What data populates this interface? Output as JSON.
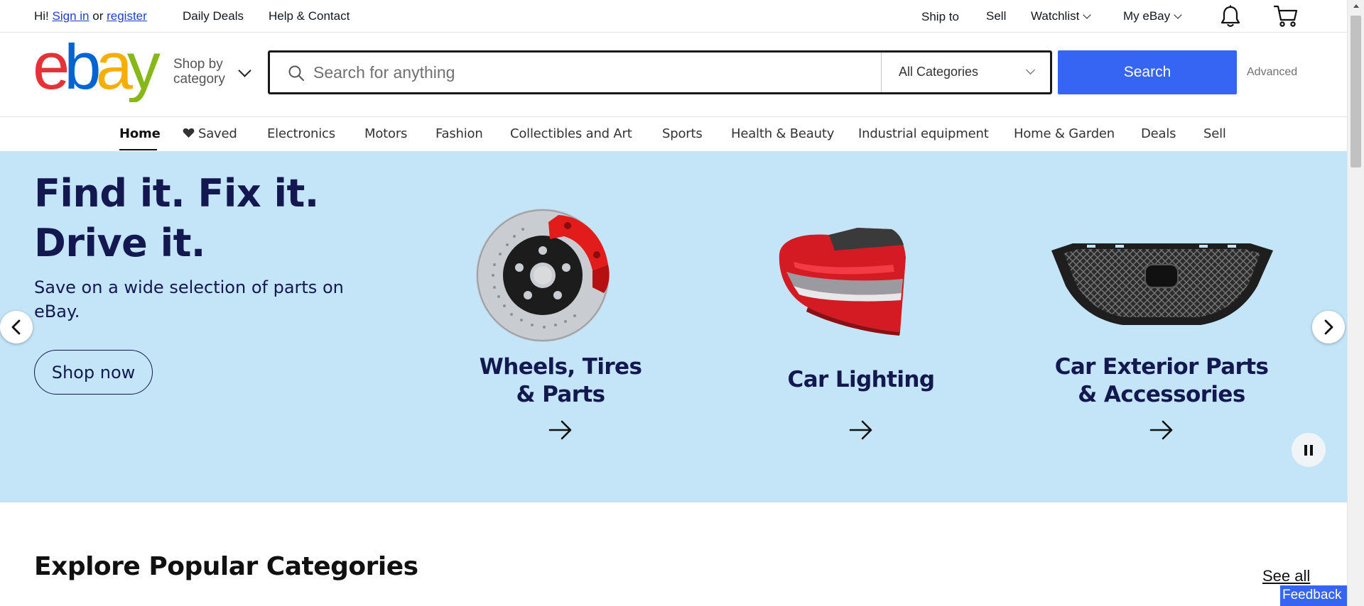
{
  "topbar": {
    "greeting": "Hi!",
    "sign_in": "Sign in",
    "or": "or",
    "register": "register",
    "daily_deals": "Daily Deals",
    "help_contact": "Help & Contact",
    "ship_to": "Ship to",
    "sell": "Sell",
    "watchlist": "Watchlist",
    "my_ebay": "My eBay",
    "icons": [
      "bell-icon",
      "cart-icon"
    ]
  },
  "header": {
    "logo_text": "ebay",
    "logo_colors": [
      "#e53238",
      "#0064d2",
      "#f5af02",
      "#86b817"
    ],
    "shop_by_category": [
      "Shop by",
      "category"
    ],
    "search": {
      "placeholder": "Search for anything",
      "category": "All Categories",
      "button": "Search",
      "advanced": "Advanced"
    },
    "accent_color": "#3665f3"
  },
  "nav": {
    "items": [
      {
        "label": "Home",
        "active": true
      },
      {
        "label": "Saved"
      },
      {
        "label": "Electronics"
      },
      {
        "label": "Motors"
      },
      {
        "label": "Fashion"
      },
      {
        "label": "Collectibles and Art"
      },
      {
        "label": "Sports"
      },
      {
        "label": "Health & Beauty"
      },
      {
        "label": "Industrial equipment"
      },
      {
        "label": "Home & Garden"
      },
      {
        "label": "Deals"
      },
      {
        "label": "Sell"
      }
    ]
  },
  "hero": {
    "background": "#c4e5f8",
    "heading_line1": "Find it. Fix it.",
    "heading_line2": "Drive it.",
    "subtext": "Save on a wide selection of parts on eBay.",
    "cta": "Shop now",
    "tiles": [
      {
        "line1": "Wheels, Tires",
        "line2": "& Parts",
        "image": "brake-disc"
      },
      {
        "line1": "Car Lighting",
        "line2": "",
        "image": "tail-light"
      },
      {
        "line1": "Car Exterior Parts",
        "line2": "& Accessories",
        "image": "front-grille"
      }
    ]
  },
  "explore": {
    "title": "Explore Popular Categories",
    "see_all": "See all"
  },
  "feedback": "Feedback"
}
